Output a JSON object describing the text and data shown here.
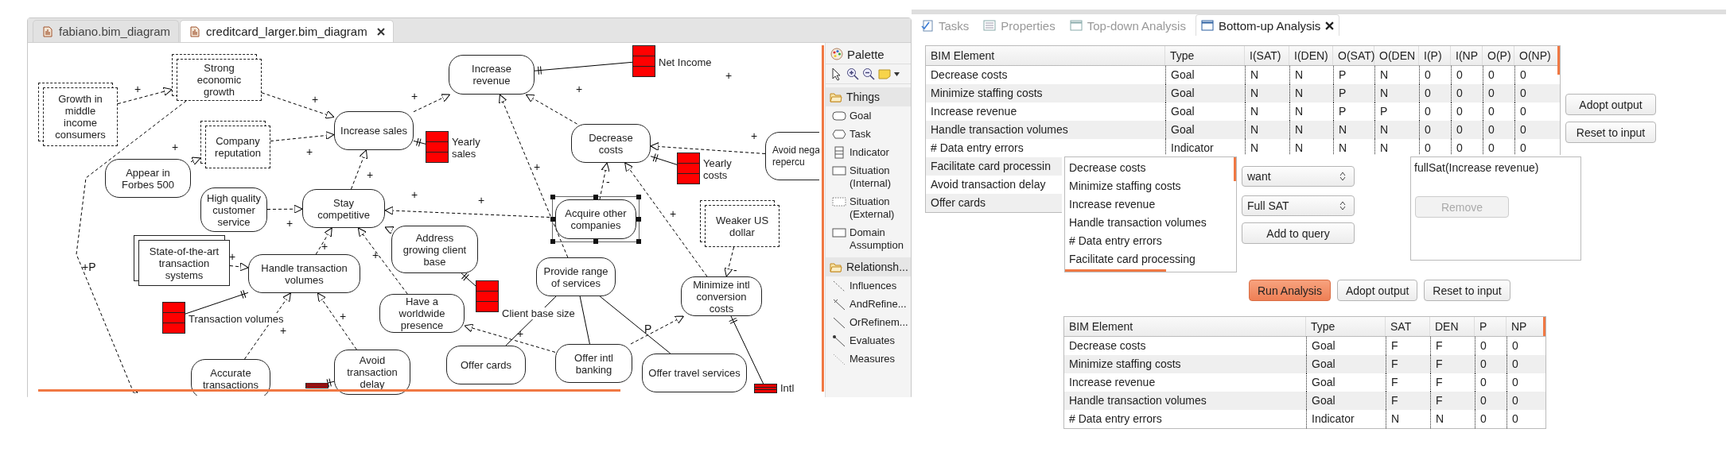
{
  "editor": {
    "tabs": [
      {
        "label": "fabiano.bim_diagram",
        "selected": false,
        "closable": false
      },
      {
        "label": "creditcard_larger.bim_diagram",
        "selected": true,
        "closable": true
      }
    ],
    "diagram": {
      "nodes": [
        {
          "label": "Strong economic growth",
          "kind": "situation_external",
          "selected": false
        },
        {
          "label": "Increase revenue",
          "kind": "goal",
          "selected": false
        },
        {
          "label": "Net Income",
          "kind": "indicator",
          "selected": false
        },
        {
          "label": "Growth in middle income consumers",
          "kind": "situation_external",
          "selected": false
        },
        {
          "label": "Company reputation",
          "kind": "situation_external",
          "selected": false
        },
        {
          "label": "Increase sales",
          "kind": "goal",
          "selected": false
        },
        {
          "label": "Yearly sales",
          "kind": "indicator",
          "selected": false
        },
        {
          "label": "Decrease costs",
          "kind": "goal",
          "selected": false
        },
        {
          "label": "Yearly costs",
          "kind": "indicator",
          "selected": false
        },
        {
          "label": "Avoid nega repercu",
          "kind": "goal",
          "selected": false
        },
        {
          "label": "Appear in Forbes 500",
          "kind": "goal",
          "selected": false
        },
        {
          "label": "High quality customer service",
          "kind": "goal",
          "selected": false
        },
        {
          "label": "Stay competitive",
          "kind": "goal",
          "selected": false
        },
        {
          "label": "Address growing client base",
          "kind": "goal",
          "selected": false
        },
        {
          "label": "Acquire other companies",
          "kind": "goal",
          "selected": true
        },
        {
          "label": "Weaker US dollar",
          "kind": "situation_external",
          "selected": false
        },
        {
          "label": "State-of-the-art transaction systems",
          "kind": "situation_internal",
          "selected": false
        },
        {
          "label": "Handle transaction volumes",
          "kind": "goal",
          "selected": false
        },
        {
          "label": "Client base size",
          "kind": "indicator",
          "selected": false
        },
        {
          "label": "Provide range of services",
          "kind": "goal",
          "selected": false
        },
        {
          "label": "Minimize intl conversion costs",
          "kind": "goal",
          "selected": false
        },
        {
          "label": "Transaction volumes",
          "kind": "indicator",
          "selected": false
        },
        {
          "label": "Have a worldwide presence",
          "kind": "goal",
          "selected": false
        },
        {
          "label": "Accurate transactions",
          "kind": "goal",
          "selected": false
        },
        {
          "kind": "indicator",
          "selected": false
        },
        {
          "label": "Avoid transaction delay",
          "kind": "goal",
          "selected": false
        },
        {
          "label": "Offer cards",
          "kind": "goal",
          "selected": false
        },
        {
          "label": "Offer intl banking",
          "kind": "goal",
          "selected": false
        },
        {
          "label": "Offer travel services",
          "kind": "goal",
          "selected": false
        },
        {
          "label": "Intl",
          "kind": "indicator",
          "selected": false
        }
      ],
      "edges": [
        {
          "kind": "influence",
          "label": "+"
        },
        {
          "kind": "influence",
          "label": "+"
        },
        {
          "kind": "influence",
          "label": "+"
        },
        {
          "kind": "influence",
          "label": "+"
        },
        {
          "kind": "influence",
          "label": "+"
        },
        {
          "kind": "influence",
          "label": "+"
        },
        {
          "kind": "influence",
          "label": "+"
        },
        {
          "kind": "influence",
          "label": "+"
        },
        {
          "kind": "influence",
          "label": "+"
        },
        {
          "kind": "influence",
          "label": "+"
        },
        {
          "kind": "influence",
          "label": "+"
        },
        {
          "kind": "influence",
          "label": "+"
        },
        {
          "kind": "influence",
          "label": "+"
        },
        {
          "kind": "influence",
          "label": "+"
        },
        {
          "kind": "influence",
          "label": "-"
        },
        {
          "kind": "influence",
          "label": "+"
        },
        {
          "kind": "influence",
          "label": "+"
        },
        {
          "kind": "influence",
          "label": "-"
        },
        {
          "kind": "influence",
          "label": "+"
        },
        {
          "kind": "influence",
          "label": "+"
        },
        {
          "kind": "influence",
          "label": "+"
        },
        {
          "kind": "influence"
        },
        {
          "kind": "influence",
          "label": "+P"
        },
        {
          "kind": "refinement"
        },
        {
          "kind": "refinement"
        },
        {
          "kind": "refinement",
          "label": "P"
        },
        {
          "kind": "measure"
        },
        {
          "kind": "measure"
        },
        {
          "kind": "measure"
        },
        {
          "kind": "measure"
        },
        {
          "kind": "measure"
        },
        {
          "kind": "measure"
        },
        {
          "kind": "measure"
        }
      ],
      "free_labels": [
        "+"
      ]
    },
    "palette": {
      "title": "Palette",
      "groups": [
        {
          "label": "Things",
          "items": [
            {
              "label": "Goal",
              "kind": "goal"
            },
            {
              "label": "Task",
              "kind": "task"
            },
            {
              "label": "Indicator",
              "kind": "indicator"
            },
            {
              "label": "Situation (Internal)",
              "kind": "situation_internal"
            },
            {
              "label": "Situation (External)",
              "kind": "situation_external"
            },
            {
              "label": "Domain Assumption",
              "kind": "domain_assumption"
            }
          ]
        },
        {
          "label": "Relationsh...",
          "items": [
            {
              "label": "Influences",
              "kind": "influences"
            },
            {
              "label": "AndRefine...",
              "kind": "and_refinement"
            },
            {
              "label": "OrRefinem...",
              "kind": "or_refinement"
            },
            {
              "label": "Evaluates",
              "kind": "evaluates"
            },
            {
              "label": "Measures",
              "kind": "measures"
            }
          ]
        }
      ]
    }
  },
  "analysis": {
    "tabs": [
      {
        "label": "Tasks",
        "kind": "tasks",
        "selected": false,
        "closable": false
      },
      {
        "label": "Properties",
        "kind": "properties",
        "selected": false,
        "closable": false
      },
      {
        "label": "Top-down Analysis",
        "kind": "view",
        "selected": false,
        "closable": false
      },
      {
        "label": "Bottom-up Analysis",
        "kind": "view",
        "selected": true,
        "closable": true
      }
    ],
    "input_table": {
      "columns": [
        "BIM Element",
        "Type",
        "I(SAT)",
        "I(DEN)",
        "O(SAT)",
        "O(DEN",
        "I(P)",
        "I(NP",
        "O(P)",
        "O(NP)"
      ],
      "rows": [
        [
          "Decrease costs",
          "Goal",
          "N",
          "N",
          "P",
          "N",
          "0",
          "0",
          "0",
          "0"
        ],
        [
          "Minimize staffing costs",
          "Goal",
          "N",
          "N",
          "P",
          "N",
          "0",
          "0",
          "0",
          "0"
        ],
        [
          "Increase revenue",
          "Goal",
          "N",
          "N",
          "P",
          "P",
          "0",
          "0",
          "0",
          "0"
        ],
        [
          "Handle transaction volumes",
          "Goal",
          "N",
          "N",
          "N",
          "N",
          "0",
          "0",
          "0",
          "0"
        ],
        [
          "# Data entry errors",
          "Indicator",
          "N",
          "N",
          "N",
          "N",
          "0",
          "0",
          "0",
          "0"
        ],
        [
          "Facilitate card processin"
        ],
        [
          "Avoid transaction delay"
        ],
        [
          "Offer cards"
        ]
      ]
    },
    "side_buttons": [
      "Adopt output",
      "Reset to input"
    ],
    "element_list": [
      "Decrease costs",
      "Minimize staffing costs",
      "Increase revenue",
      "Handle transaction volumes",
      "# Data entry errors",
      "Facilitate card processing"
    ],
    "mode_select": "want",
    "value_select": "Full SAT",
    "add_button": "Add to query",
    "query": [
      "fullSat(Increase revenue)"
    ],
    "remove_button": {
      "label": "Remove",
      "disabled": true
    },
    "actions": [
      {
        "label": "Run Analysis",
        "default": true
      },
      {
        "label": "Adopt output",
        "default": false
      },
      {
        "label": "Reset to input",
        "default": false
      }
    ],
    "output_table": {
      "columns": [
        "BIM Element",
        "Type",
        "SAT",
        "DEN",
        "P",
        "NP"
      ],
      "rows": [
        [
          "Decrease costs",
          "Goal",
          "F",
          "F",
          "0",
          "0"
        ],
        [
          "Minimize staffing costs",
          "Goal",
          "F",
          "F",
          "0",
          "0"
        ],
        [
          "Increase revenue",
          "Goal",
          "F",
          "F",
          "0",
          "0"
        ],
        [
          "Handle transaction volumes",
          "Goal",
          "F",
          "F",
          "0",
          "0"
        ],
        [
          "# Data entry errors",
          "Indicator",
          "N",
          "N",
          "0",
          "0"
        ]
      ]
    }
  }
}
